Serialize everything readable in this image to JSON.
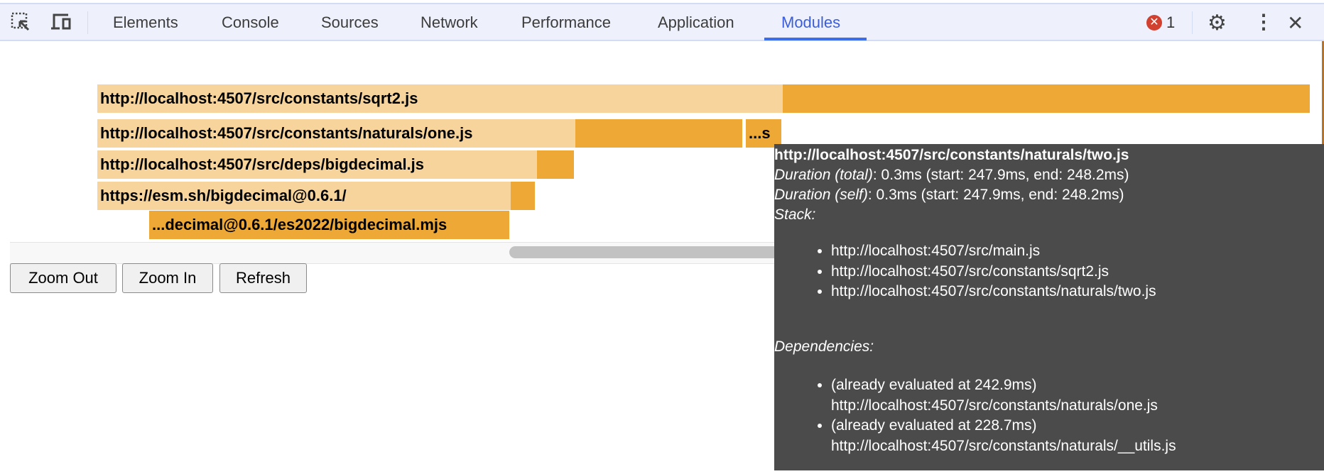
{
  "toolbar": {
    "tabs": [
      "Elements",
      "Console",
      "Sources",
      "Network",
      "Performance",
      "Application",
      "Modules"
    ],
    "active_tab": "Modules",
    "error_count": "1",
    "accent": "#3b6ee8"
  },
  "flamechart": {
    "rows": [
      {
        "label": "http://localhost:4507/src/constants/sqrt2.js"
      },
      {
        "label": "http://localhost:4507/src/constants/naturals/one.js",
        "child_label": "...s"
      },
      {
        "label": "http://localhost:4507/src/deps/bigdecimal.js"
      },
      {
        "label": "https://esm.sh/bigdecimal@0.6.1/"
      },
      {
        "label": "...decimal@0.6.1/es2022/bigdecimal.mjs"
      }
    ],
    "colors": {
      "total": "#f6d49b",
      "self": "#eea835"
    }
  },
  "controls": {
    "zoom_out": "Zoom Out",
    "zoom_in": "Zoom In",
    "refresh": "Refresh"
  },
  "tooltip": {
    "title": "http://localhost:4507/src/constants/naturals/two.js",
    "duration_total_label": "Duration (total)",
    "duration_total_value": ": 0.3ms (start: 247.9ms, end: 248.2ms)",
    "duration_self_label": "Duration (self)",
    "duration_self_value": ": 0.3ms (start: 247.9ms, end: 248.2ms)",
    "stack_label": "Stack:",
    "stack": [
      "http://localhost:4507/src/main.js",
      "http://localhost:4507/src/constants/sqrt2.js",
      "http://localhost:4507/src/constants/naturals/two.js"
    ],
    "dependencies_label": "Dependencies:",
    "dependencies": [
      {
        "note": "(already evaluated at 242.9ms)",
        "url": "http://localhost:4507/src/constants/naturals/one.js"
      },
      {
        "note": "(already evaluated at 228.7ms)",
        "url": "http://localhost:4507/src/constants/naturals/__utils.js"
      }
    ]
  }
}
